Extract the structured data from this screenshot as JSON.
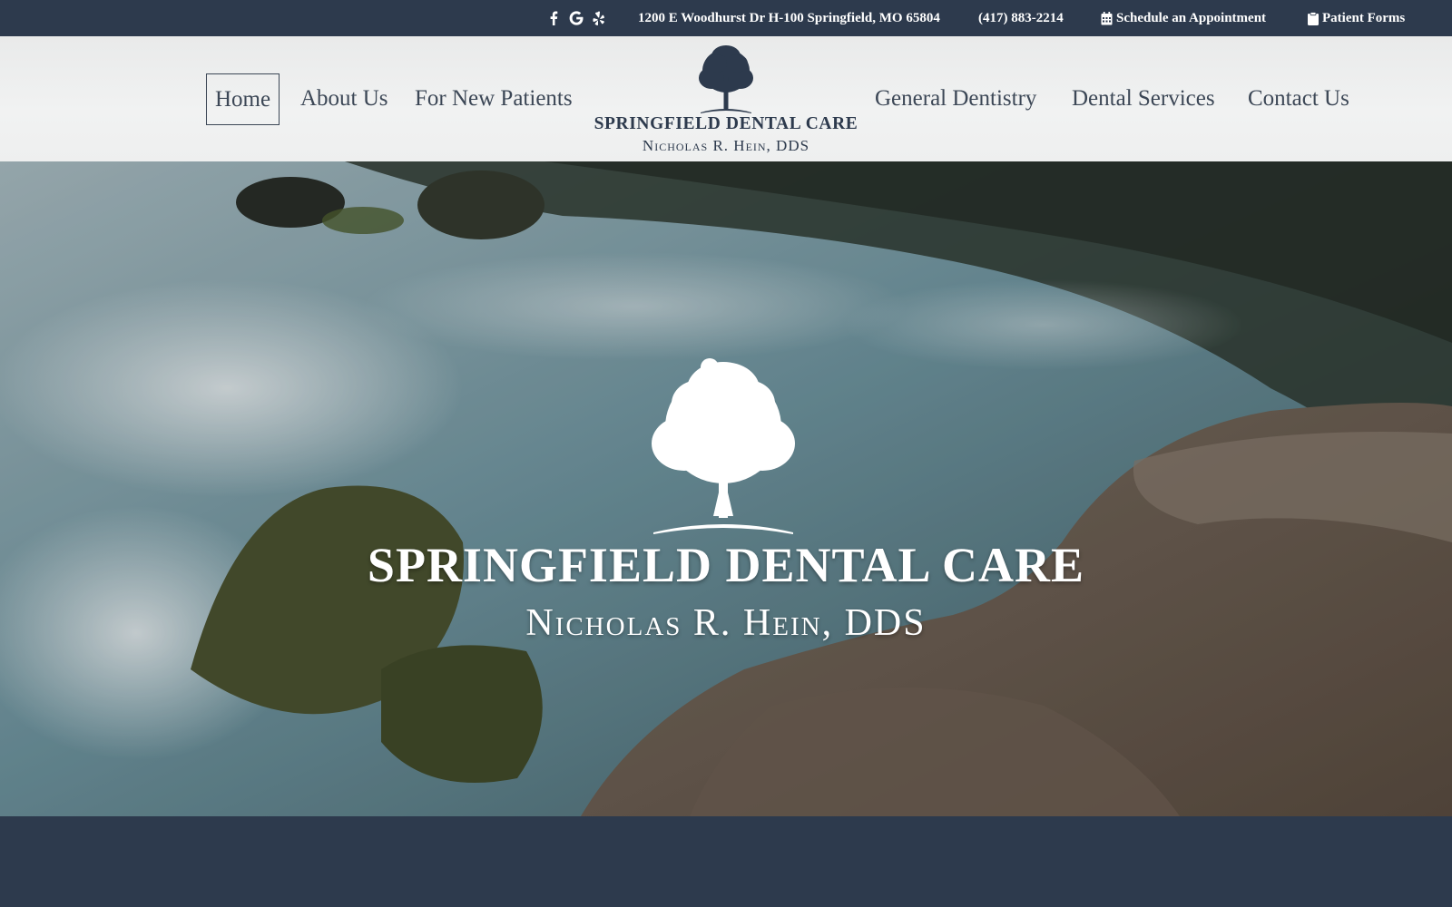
{
  "topbar": {
    "social_icons": [
      "facebook-icon",
      "google-icon",
      "yelp-icon"
    ],
    "address": "1200 E Woodhurst Dr H-100 Springfield, MO 65804",
    "phone": "(417) 883-2214",
    "appointment_label": "Schedule an Appointment",
    "appointment_icon": "calendar-icon",
    "forms_label": "Patient Forms",
    "forms_icon": "clipboard-icon"
  },
  "nav": {
    "left": [
      "Home",
      "About Us",
      "For New Patients"
    ],
    "right": [
      "General Dentistry",
      "Dental Services",
      "Contact Us"
    ],
    "active": "Home"
  },
  "logo": {
    "name": "SPRINGFIELD DENTAL CARE",
    "subtitle": "Nicholas R. Hein, DDS",
    "icon": "tree-logo-icon"
  },
  "hero": {
    "title": "SPRINGFIELD DENTAL CARE",
    "subtitle": "Nicholas R. Hein, DDS",
    "icon": "tree-logo-icon"
  },
  "colors": {
    "navy": "#2d3a4d",
    "header_bg": "#f1f2f2",
    "nav_text": "#3c4756",
    "white": "#ffffff"
  }
}
